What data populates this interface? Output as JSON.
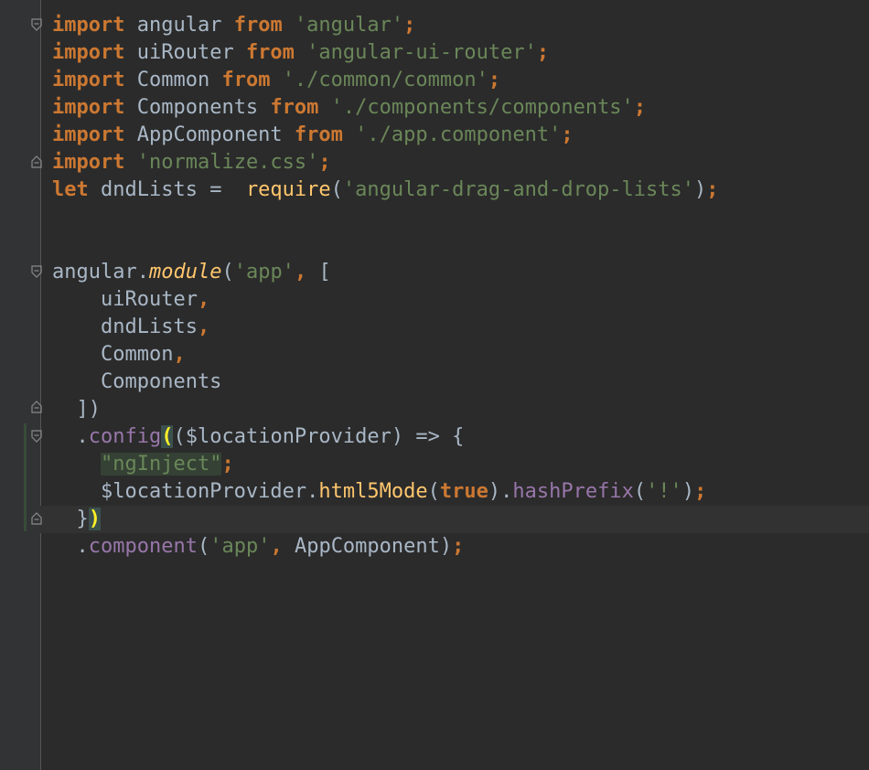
{
  "editor": {
    "lines": [
      [
        {
          "t": "import",
          "c": "kw"
        },
        {
          "t": " angular "
        },
        {
          "t": "from",
          "c": "kw"
        },
        {
          "t": " "
        },
        {
          "t": "'angular'",
          "c": "str"
        },
        {
          "t": ";",
          "c": "kw"
        }
      ],
      [
        {
          "t": "import",
          "c": "kw"
        },
        {
          "t": " uiRouter "
        },
        {
          "t": "from",
          "c": "kw"
        },
        {
          "t": " "
        },
        {
          "t": "'angular-ui-router'",
          "c": "str"
        },
        {
          "t": ";",
          "c": "kw"
        }
      ],
      [
        {
          "t": "import",
          "c": "kw"
        },
        {
          "t": " Common "
        },
        {
          "t": "from",
          "c": "kw"
        },
        {
          "t": " "
        },
        {
          "t": "'./common/common'",
          "c": "str"
        },
        {
          "t": ";",
          "c": "kw"
        }
      ],
      [
        {
          "t": "import",
          "c": "kw"
        },
        {
          "t": " Components "
        },
        {
          "t": "from",
          "c": "kw"
        },
        {
          "t": " "
        },
        {
          "t": "'./components/components'",
          "c": "str"
        },
        {
          "t": ";",
          "c": "kw"
        }
      ],
      [
        {
          "t": "import",
          "c": "kw"
        },
        {
          "t": " AppComponent "
        },
        {
          "t": "from",
          "c": "kw"
        },
        {
          "t": " "
        },
        {
          "t": "'./app.component'",
          "c": "str"
        },
        {
          "t": ";",
          "c": "kw"
        }
      ],
      [
        {
          "t": "import",
          "c": "kw"
        },
        {
          "t": " "
        },
        {
          "t": "'normalize.css'",
          "c": "str"
        },
        {
          "t": ";",
          "c": "kw"
        }
      ],
      [
        {
          "t": "let",
          "c": "kw"
        },
        {
          "t": " dndLists =  "
        },
        {
          "t": "require",
          "c": "fn"
        },
        {
          "t": "("
        },
        {
          "t": "'angular-drag-and-drop-lists'",
          "c": "str"
        },
        {
          "t": ")"
        },
        {
          "t": ";",
          "c": "kw"
        }
      ],
      [],
      [],
      [
        {
          "t": "angular."
        },
        {
          "t": "module",
          "c": "fni"
        },
        {
          "t": "("
        },
        {
          "t": "'app'",
          "c": "str"
        },
        {
          "t": ", ",
          "c": "kw"
        },
        {
          "t": "["
        }
      ],
      [
        {
          "t": "    uiRouter"
        },
        {
          "t": ",",
          "c": "kw"
        }
      ],
      [
        {
          "t": "    dndLists"
        },
        {
          "t": ",",
          "c": "kw"
        }
      ],
      [
        {
          "t": "    Common"
        },
        {
          "t": ",",
          "c": "kw"
        }
      ],
      [
        {
          "t": "    Components"
        }
      ],
      [
        {
          "t": "  ])"
        }
      ],
      [
        {
          "t": "  ."
        },
        {
          "t": "config",
          "c": "meth"
        },
        {
          "t": "(",
          "c": "paren-hl"
        },
        {
          "t": "($locationProvider) => {"
        }
      ],
      [
        {
          "t": "    "
        },
        {
          "t": "\"ngInject\"",
          "c": "inject"
        },
        {
          "t": ";",
          "c": "kw"
        }
      ],
      [
        {
          "t": "    $locationProvider."
        },
        {
          "t": "html5Mode",
          "c": "fn"
        },
        {
          "t": "("
        },
        {
          "t": "true",
          "c": "kw"
        },
        {
          "t": ")."
        },
        {
          "t": "hashPrefix",
          "c": "meth"
        },
        {
          "t": "("
        },
        {
          "t": "'!'",
          "c": "str"
        },
        {
          "t": ")"
        },
        {
          "t": ";",
          "c": "kw"
        }
      ],
      [
        {
          "t": "  }"
        },
        {
          "t": ")",
          "c": "paren-hl"
        }
      ],
      [
        {
          "t": "  ."
        },
        {
          "t": "component",
          "c": "meth"
        },
        {
          "t": "("
        },
        {
          "t": "'app'",
          "c": "str"
        },
        {
          "t": ", ",
          "c": "kw"
        },
        {
          "t": "AppComponent)"
        },
        {
          "t": ";",
          "c": "kw"
        }
      ]
    ]
  }
}
